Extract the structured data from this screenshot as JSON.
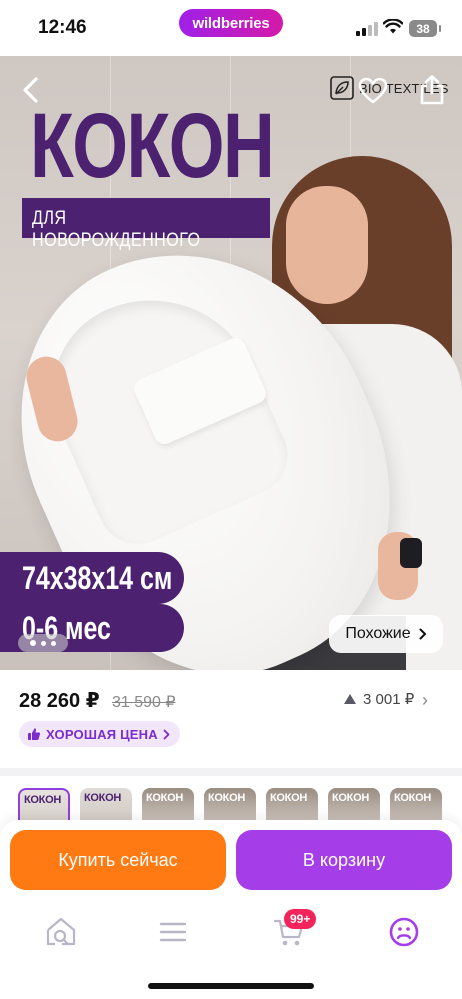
{
  "status_bar": {
    "time": "12:46",
    "battery": "38"
  },
  "brand": {
    "name": "wildberries"
  },
  "hero": {
    "title": "КОКОН",
    "subtitle": "ДЛЯ НОВОРОЖДЕННОГО",
    "size_text": "74х38х14 см",
    "age_text": "0-6 мес",
    "brand_logo_text": "BIO TEXTILES",
    "similar_label": "Похожие",
    "slide_index": 1
  },
  "price": {
    "current": "28 260 ₽",
    "old": "31 590 ₽",
    "points": "3 001 ₽",
    "badge": "ХОРОШАЯ ЦЕНА"
  },
  "thumbnails": [
    {
      "label": "КОКОН",
      "active": true
    },
    {
      "label": "КОКОН",
      "active": false
    },
    {
      "label": "КОКОН",
      "active": false
    },
    {
      "label": "КОКОН",
      "active": false
    },
    {
      "label": "КОКОН",
      "active": false
    },
    {
      "label": "КОКОН",
      "active": false
    },
    {
      "label": "КОКОН",
      "active": false
    }
  ],
  "actions": {
    "buy_now": "Купить сейчас",
    "add_to_cart": "В корзину"
  },
  "nav": {
    "cart_badge": "99+"
  },
  "colors": {
    "brand_purple": "#a53ee8",
    "buy_orange": "#ff7a12",
    "badge_red": "#f2245b",
    "hero_purple": "#4b2170"
  }
}
